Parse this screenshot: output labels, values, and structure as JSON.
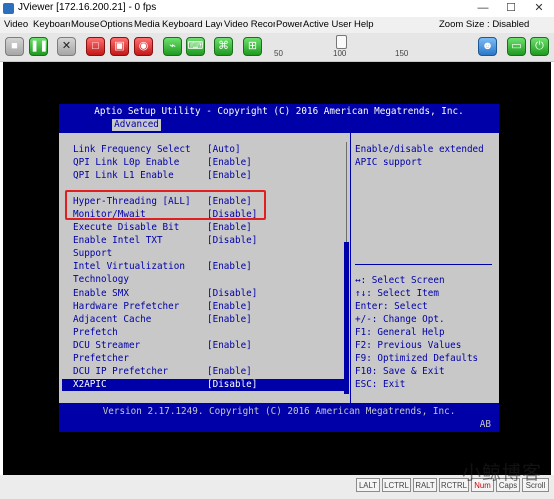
{
  "window": {
    "title": "JViewer [172.16.200.21] - 0 fps",
    "controls": [
      "—",
      "☐",
      "✕"
    ]
  },
  "menu": {
    "items": [
      "Video",
      "Keyboard",
      "Mouse",
      "Options",
      "Media",
      "Keyboard Layo",
      "Video Recor",
      "Power",
      "Active User",
      "Help"
    ],
    "zoom_label": "Zoom Size : Disabled"
  },
  "toolbar": {
    "slider_labels": [
      "50",
      "100",
      "150"
    ]
  },
  "bios": {
    "header": "Aptio Setup Utility - Copyright (C) 2016 American Megatrends, Inc.",
    "tab": "Advanced",
    "settings": [
      {
        "label": "Link Frequency Select",
        "value": "[Auto]"
      },
      {
        "label": "QPI Link L0p Enable",
        "value": "[Enable]"
      },
      {
        "label": "QPI Link L1 Enable",
        "value": "[Enable]"
      },
      {
        "label": "Hyper-Threading [ALL]",
        "value": "[Enable]"
      },
      {
        "label": "Monitor/Mwait",
        "value": "[Disable]"
      },
      {
        "label": "Execute Disable Bit",
        "value": "[Enable]"
      },
      {
        "label": "Enable Intel TXT",
        "value": "[Disable]"
      },
      {
        "label": "Support",
        "value": ""
      },
      {
        "label": "Intel Virtualization",
        "value": "[Enable]"
      },
      {
        "label": "Technology",
        "value": ""
      },
      {
        "label": "Enable SMX",
        "value": "[Disable]"
      },
      {
        "label": "Hardware Prefetcher",
        "value": "[Enable]"
      },
      {
        "label": "Adjacent Cache",
        "value": "[Enable]"
      },
      {
        "label": "Prefetch",
        "value": ""
      },
      {
        "label": "DCU Streamer",
        "value": "[Enable]"
      },
      {
        "label": "Prefetcher",
        "value": ""
      },
      {
        "label": "DCU IP Prefetcher",
        "value": "[Enable]"
      },
      {
        "label": "X2APIC",
        "value": "[Disable]"
      }
    ],
    "help_lines": [
      "Enable/disable extended",
      "APIC support"
    ],
    "key_help": [
      "↔: Select Screen",
      "↑↓: Select Item",
      "Enter: Select",
      "+/-: Change Opt.",
      "F1: General Help",
      "F2: Previous Values",
      "F9: Optimized Defaults",
      "F10: Save & Exit",
      "ESC: Exit"
    ],
    "footer": "Version 2.17.1249. Copyright (C) 2016 American Megatrends, Inc.",
    "footer_code": "AB"
  },
  "status_keys": [
    "LALT",
    "LCTRL",
    "RALT",
    "RCTRL",
    "Num",
    "Caps",
    "Scroll"
  ],
  "watermark": "小鲸博客",
  "colors": {
    "bios_blue": "#0000a8",
    "bios_gray": "#c8c8c8",
    "highlight_red": "#e02020"
  }
}
